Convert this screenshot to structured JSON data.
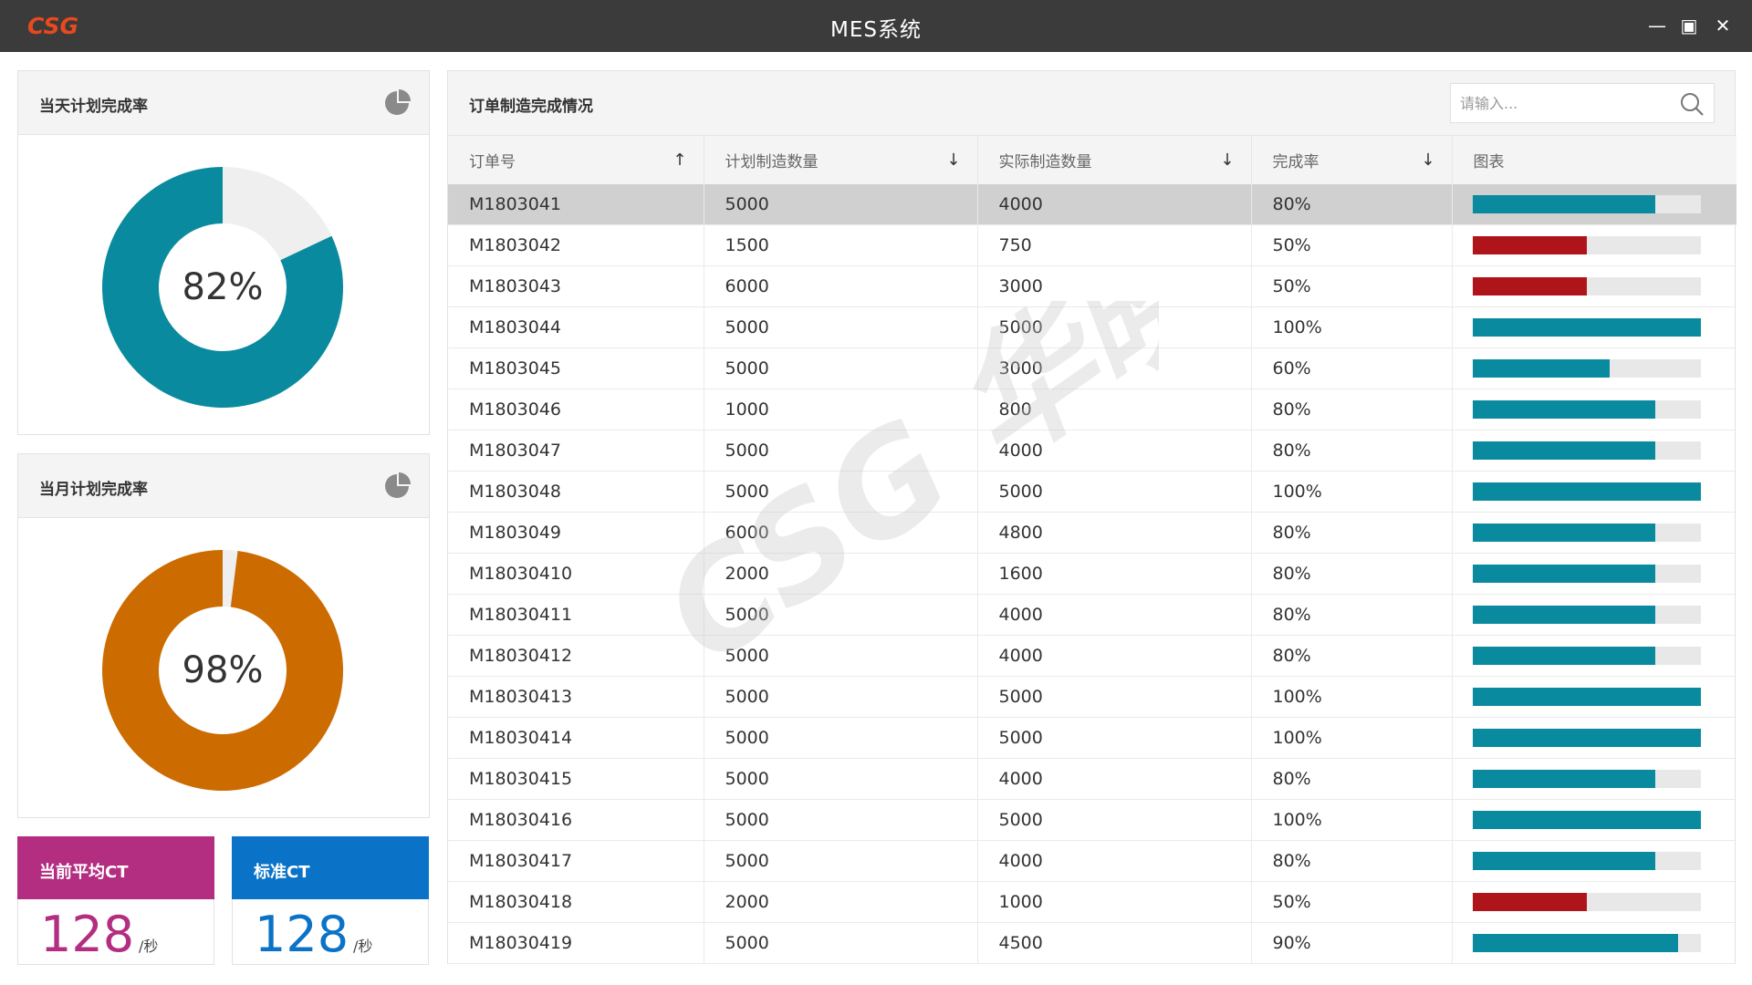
{
  "window": {
    "logo_text": "CSG",
    "title": "MES系统",
    "minimize_glyph": "—",
    "maximize_glyph": "▣",
    "close_glyph": "✕"
  },
  "daily_panel": {
    "title": "当天计划完成率",
    "icon": "pie-chart-icon",
    "percent_label": "82%",
    "value": 0.82,
    "color": "#0a8a9f"
  },
  "monthly_panel": {
    "title": "当月计划完成率",
    "icon": "pie-chart-icon",
    "percent_label": "98%",
    "value": 0.98,
    "color": "#cc6c00"
  },
  "avg_ct": {
    "label": "当前平均CT",
    "value": "128",
    "unit": "/秒",
    "color": "#b32d80"
  },
  "std_ct": {
    "label": "标准CT",
    "value": "128",
    "unit": "/秒",
    "color": "#0a73c7"
  },
  "orders": {
    "title": "订单制造完成情况",
    "search_placeholder": "请输入...",
    "columns": [
      {
        "label": "订单号",
        "sort": "↑"
      },
      {
        "label": "计划制造数量",
        "sort": "↓"
      },
      {
        "label": "实际制造数量",
        "sort": "↓"
      },
      {
        "label": "完成率",
        "sort": "↓"
      },
      {
        "label": "图表",
        "sort": ""
      }
    ],
    "colors": {
      "normal": "#0a8a9f",
      "low": "#b0141b",
      "track": "#e8e8e8"
    },
    "rows": [
      {
        "id": "M1803041",
        "plan": "5000",
        "actual": "4000",
        "rate": "80%",
        "ratio": 0.8,
        "selected": true
      },
      {
        "id": "M1803042",
        "plan": "1500",
        "actual": "750",
        "rate": "50%",
        "ratio": 0.5
      },
      {
        "id": "M1803043",
        "plan": "6000",
        "actual": "3000",
        "rate": "50%",
        "ratio": 0.5
      },
      {
        "id": "M1803044",
        "plan": "5000",
        "actual": "5000",
        "rate": "100%",
        "ratio": 1.0
      },
      {
        "id": "M1803045",
        "plan": "5000",
        "actual": "3000",
        "rate": "60%",
        "ratio": 0.6
      },
      {
        "id": "M1803046",
        "plan": "1000",
        "actual": "800",
        "rate": "80%",
        "ratio": 0.8
      },
      {
        "id": "M1803047",
        "plan": "5000",
        "actual": "4000",
        "rate": "80%",
        "ratio": 0.8
      },
      {
        "id": "M1803048",
        "plan": "5000",
        "actual": "5000",
        "rate": "100%",
        "ratio": 1.0
      },
      {
        "id": "M1803049",
        "plan": "6000",
        "actual": "4800",
        "rate": "80%",
        "ratio": 0.8
      },
      {
        "id": "M18030410",
        "plan": "2000",
        "actual": "1600",
        "rate": "80%",
        "ratio": 0.8
      },
      {
        "id": "M18030411",
        "plan": "5000",
        "actual": "4000",
        "rate": "80%",
        "ratio": 0.8
      },
      {
        "id": "M18030412",
        "plan": "5000",
        "actual": "4000",
        "rate": "80%",
        "ratio": 0.8
      },
      {
        "id": "M18030413",
        "plan": "5000",
        "actual": "5000",
        "rate": "100%",
        "ratio": 1.0
      },
      {
        "id": "M18030414",
        "plan": "5000",
        "actual": "5000",
        "rate": "100%",
        "ratio": 1.0
      },
      {
        "id": "M18030415",
        "plan": "5000",
        "actual": "4000",
        "rate": "80%",
        "ratio": 0.8
      },
      {
        "id": "M18030416",
        "plan": "5000",
        "actual": "5000",
        "rate": "100%",
        "ratio": 1.0
      },
      {
        "id": "M18030417",
        "plan": "5000",
        "actual": "4000",
        "rate": "80%",
        "ratio": 0.8
      },
      {
        "id": "M18030418",
        "plan": "2000",
        "actual": "1000",
        "rate": "50%",
        "ratio": 0.5
      },
      {
        "id": "M18030419",
        "plan": "5000",
        "actual": "4500",
        "rate": "90%",
        "ratio": 0.9
      }
    ]
  },
  "watermark": {
    "text": "CSG 华晓"
  }
}
